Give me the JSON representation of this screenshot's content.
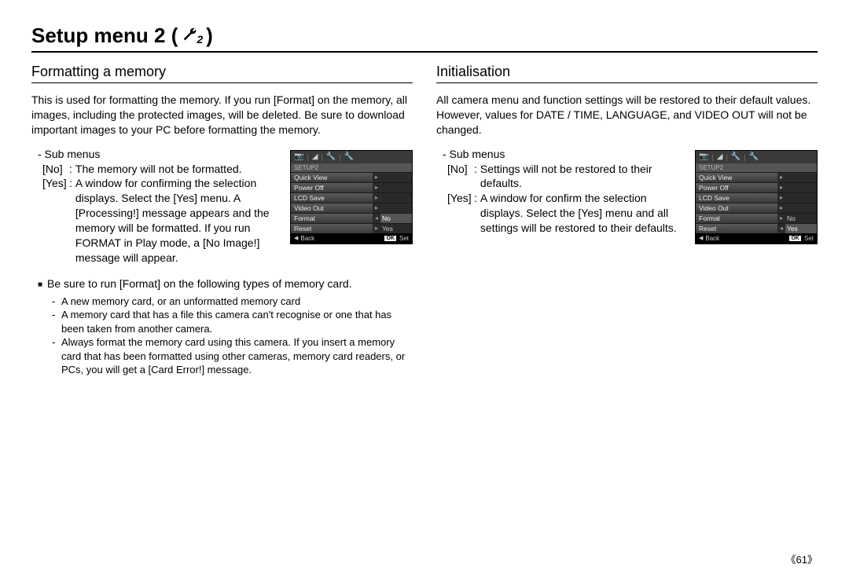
{
  "title_prefix": "Setup menu 2 (",
  "title_suffix": " )",
  "icon_sub": "2",
  "left": {
    "heading": "Formatting a memory",
    "intro": "This is used for formatting the memory. If you run [Format] on the memory, all images, including the protected images, will be deleted. Be sure to download important images to your PC before formatting the memory.",
    "submenus_label": "- Sub menus",
    "no_key": "[No]",
    "no_val": "The memory will not be formatted.",
    "yes_key": "[Yes]",
    "yes_val": "A window for confirming the selection displays. Select the [Yes] menu. A [Processing!] message appears and the memory will be formatted. If you run FORMAT in Play mode, a [No Image!] message will appear.",
    "bullet": "Be sure to run [Format] on the following types of memory card.",
    "dash1": "A new memory card, or an unformatted memory card",
    "dash2": "A memory card that has a file this camera can't recognise or one that has been taken from another camera.",
    "dash3": "Always format the memory card using this camera. If you insert a memory card that has been formatted using other cameras, memory card readers, or PCs, you will get a [Card Error!] message.",
    "screen": {
      "setup_label": "SETUP2",
      "rows": [
        {
          "label": "Quick View",
          "arrow": "▸",
          "val": ""
        },
        {
          "label": "Power Off",
          "arrow": "▸",
          "val": ""
        },
        {
          "label": "LCD Save",
          "arrow": "▸",
          "val": ""
        },
        {
          "label": "Video Out",
          "arrow": "▸",
          "val": ""
        },
        {
          "label": "Format",
          "arrow": "◂",
          "val": "No",
          "sel": true
        },
        {
          "label": "Reset",
          "arrow": "▸",
          "val": "Yes"
        }
      ],
      "back": "Back",
      "ok": "OK",
      "set": "Set"
    }
  },
  "right": {
    "heading": "Initialisation",
    "intro": "All camera menu and function settings will be restored to their default values. However, values for DATE / TIME, LANGUAGE, and VIDEO OUT will not be changed.",
    "submenus_label": "- Sub menus",
    "no_key": "[No]",
    "no_val": "Settings will not be restored to their defaults.",
    "yes_key": "[Yes]",
    "yes_val": "A window for confirm the selection displays. Select the [Yes] menu and all settings will be restored to their defaults.",
    "screen": {
      "setup_label": "SETUP2",
      "rows": [
        {
          "label": "Quick View",
          "arrow": "▸",
          "val": ""
        },
        {
          "label": "Power Off",
          "arrow": "▸",
          "val": ""
        },
        {
          "label": "LCD Save",
          "arrow": "▸",
          "val": ""
        },
        {
          "label": "Video Out",
          "arrow": "▸",
          "val": ""
        },
        {
          "label": "Format",
          "arrow": "▸",
          "val": "No"
        },
        {
          "label": "Reset",
          "arrow": "◂",
          "val": "Yes",
          "sel": true
        }
      ],
      "back": "Back",
      "ok": "OK",
      "set": "Set"
    }
  },
  "page_number": "《61》"
}
